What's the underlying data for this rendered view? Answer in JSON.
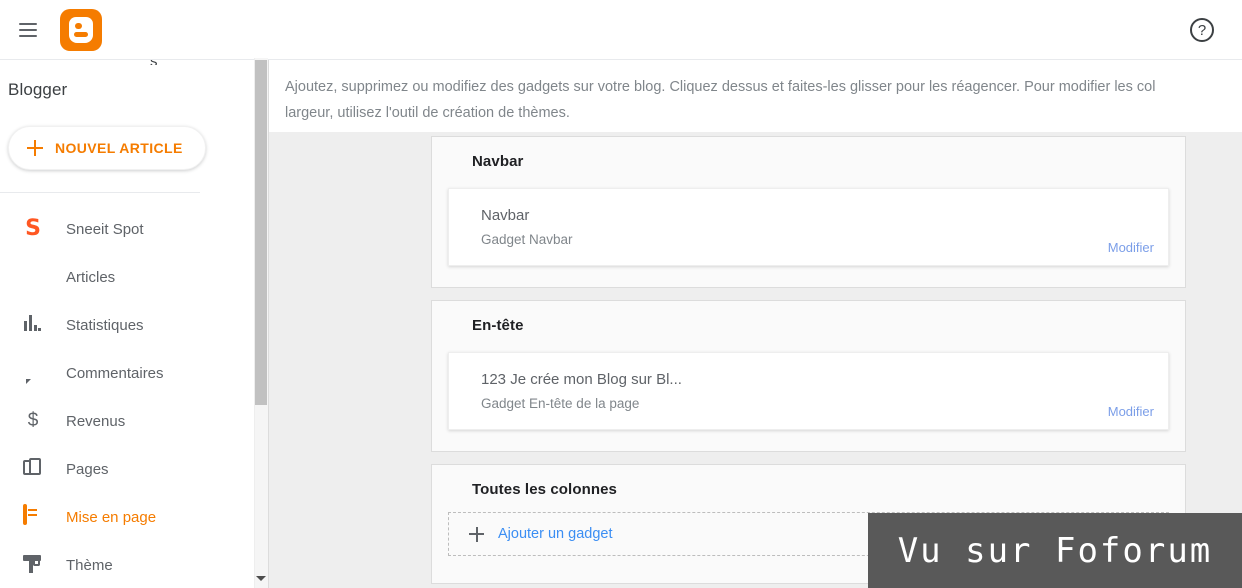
{
  "topbar": {
    "menu_icon": "hamburger-icon",
    "logo_icon": "blogger-logo-icon",
    "help_icon": "help-circle-icon",
    "help_glyph": "?"
  },
  "sidebar": {
    "cut_text": "s",
    "brand": "Blogger",
    "new_post_label": "NOUVEL ARTICLE",
    "items": [
      {
        "label": "Sneeit Spot",
        "icon": "blog-s-icon",
        "active": false
      },
      {
        "label": "Articles",
        "icon": "articles-icon",
        "active": false
      },
      {
        "label": "Statistiques",
        "icon": "stats-icon",
        "active": false
      },
      {
        "label": "Commentaires",
        "icon": "comment-icon",
        "active": false
      },
      {
        "label": "Revenus",
        "icon": "dollar-icon",
        "active": false
      },
      {
        "label": "Pages",
        "icon": "pages-icon",
        "active": false
      },
      {
        "label": "Mise en page",
        "icon": "layout-icon",
        "active": true
      },
      {
        "label": "Thème",
        "icon": "theme-brush-icon",
        "active": false
      }
    ]
  },
  "main": {
    "intro_line1_a": "Ajoutez, supprimez ou modifiez des gadgets sur votre blog. Cliquez dessus et faites-les glisser pour les réagencer. Pour modifier les col",
    "intro_line2_a": "largeur, utilisez l'",
    "intro_link": "outil de création de thèmes",
    "intro_line2_b": ".",
    "edit_label": "Modifier",
    "sections": [
      {
        "title": "Navbar",
        "gadgets": [
          {
            "title": "Navbar",
            "subtitle": "Gadget Navbar",
            "edit": "Modifier"
          }
        ]
      },
      {
        "title": "En-tête",
        "gadgets": [
          {
            "title": "123 Je crée mon Blog sur Bl...",
            "subtitle": "Gadget En-tête de la page",
            "edit": "Modifier"
          }
        ]
      },
      {
        "title": "Toutes les colonnes",
        "add_gadget_label": "Ajouter un gadget"
      }
    ]
  },
  "watermark": {
    "text": "Vu sur Foforum"
  },
  "colors": {
    "accent_orange": "#f57c00",
    "link_blue": "#3b78e7",
    "text_gray": "#5f6368",
    "panel_gray": "#eeeeee",
    "watermark_bg": "#595959"
  }
}
